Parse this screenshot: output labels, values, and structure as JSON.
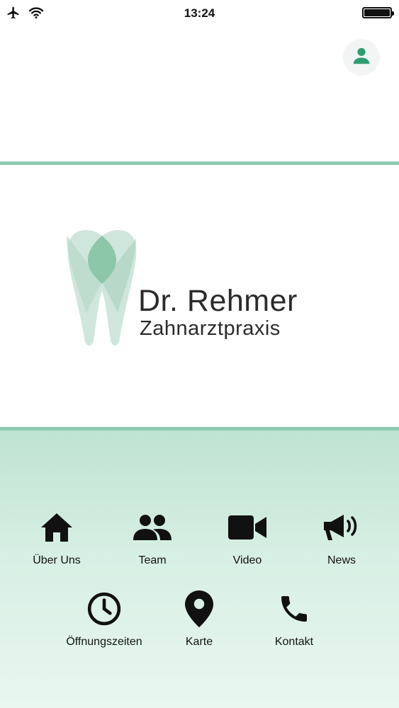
{
  "status_bar": {
    "time": "13:24"
  },
  "header": {
    "profile_icon": "person-icon"
  },
  "logo": {
    "title": "Dr. Rehmer",
    "subtitle": "Zahnarztpraxis",
    "icon": "tooth-logo"
  },
  "colors": {
    "accent": "#2e9e70",
    "divider": "#8fcbb2",
    "menu_gradient_top": "#bfe3d2",
    "menu_gradient_bottom": "#e9f7f0"
  },
  "menu": {
    "row1": [
      {
        "label": "Über Uns",
        "icon": "home-icon"
      },
      {
        "label": "Team",
        "icon": "group-icon"
      },
      {
        "label": "Video",
        "icon": "video-camera-icon"
      },
      {
        "label": "News",
        "icon": "megaphone-icon"
      }
    ],
    "row2": [
      {
        "label": "Öffnungszeiten",
        "icon": "clock-icon"
      },
      {
        "label": "Karte",
        "icon": "map-pin-icon"
      },
      {
        "label": "Kontakt",
        "icon": "phone-icon"
      }
    ]
  }
}
